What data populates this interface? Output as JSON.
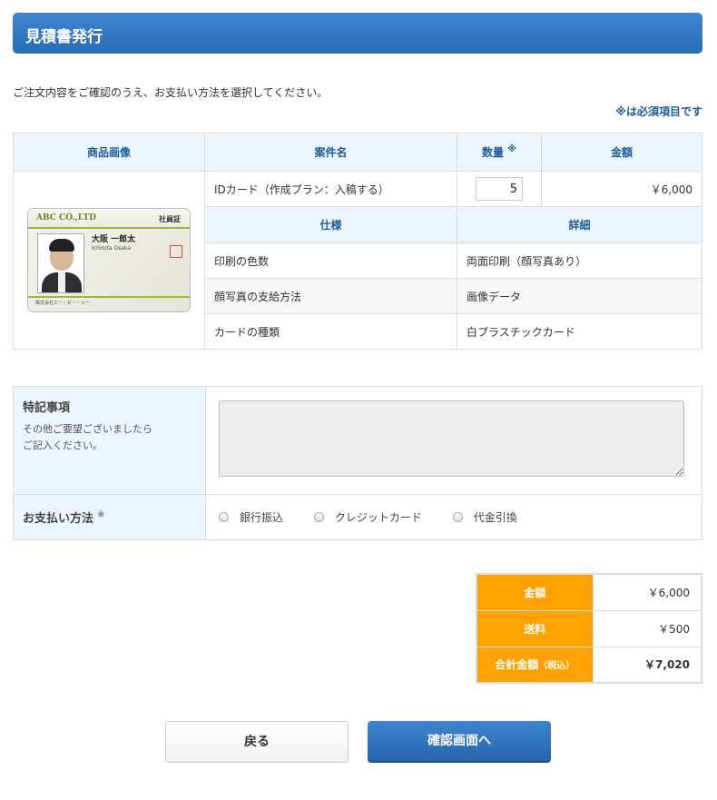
{
  "header": {
    "title": "見積書発行"
  },
  "intro_text": "ご注文内容をご確認のうえ、お支払い方法を選択してください。",
  "required_note": "※は必須項目です",
  "order_table": {
    "headers": {
      "image": "商品画像",
      "name": "案件名",
      "quantity": "数量",
      "quantity_mark": "※",
      "price": "金額"
    },
    "item": {
      "name": "IDカード（作成プラン：入稿する）",
      "quantity": "5",
      "price": "￥6,000"
    },
    "spec_headers": {
      "spec": "仕様",
      "detail": "詳細"
    },
    "specs": [
      {
        "label": "印刷の色数",
        "value": "両面印刷（顔写真あり）"
      },
      {
        "label": "顔写真の支給方法",
        "value": "画像データ"
      },
      {
        "label": "カードの種類",
        "value": "白プラスチックカード"
      }
    ],
    "card_image": {
      "logo": "ABC CO.,LTD",
      "label": "社員証",
      "name": "大阪 一郎太",
      "name_roman": "Ichirota Osaka",
      "company": "株式会社エー・ビー・シー"
    }
  },
  "notes": {
    "title": "特記事項",
    "subtitle_line1": "その他ご要望ございましたら",
    "subtitle_line2": "ご記入ください。",
    "value": ""
  },
  "payment": {
    "label": "お支払い方法",
    "mark": "※",
    "options": [
      "銀行振込",
      "クレジットカード",
      "代金引換"
    ]
  },
  "totals": {
    "amount_label": "金額",
    "amount_value": "￥6,000",
    "shipping_label": "送料",
    "shipping_value": "￥500",
    "total_label": "合計金額",
    "total_tax_note": "（税込）",
    "total_value": "￥7,020"
  },
  "buttons": {
    "back": "戻る",
    "confirm": "確認画面へ"
  },
  "colors": {
    "primary": "#2a6db5",
    "accent": "#ffa200",
    "table_header_bg": "#eaf5fd"
  }
}
